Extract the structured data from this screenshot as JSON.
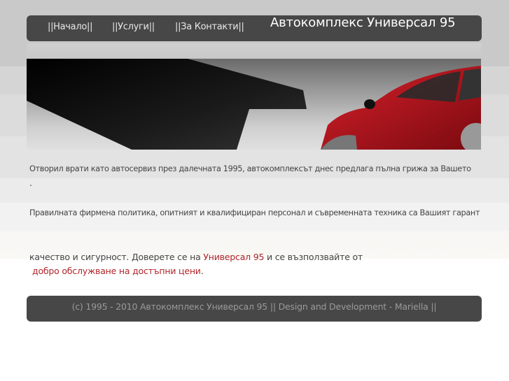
{
  "nav": {
    "items": [
      {
        "label": "||Начало||"
      },
      {
        "label": "||Услуги||"
      },
      {
        "label": "||За Контакти||"
      }
    ]
  },
  "site_title": "Автокомплекс Универсал 95",
  "content": {
    "p1": "Отворил врати като автосервиз през далечната 1995, автокомплексът днес предлага пълна грижа за Вашето",
    "p1_end": ".",
    "p2": "Правилната фирмена политика, опитният и квалифициран персонал и съвременната техника са Вашият гарант",
    "p3_a": "качество и сигурност. Доверете се на ",
    "p3_link": "Универсал 95",
    "p3_b": " и се възползвайте от",
    "p4_link": "добро обслужване на достъпни цени",
    "p4_end": "."
  },
  "footer": {
    "text": "(c) 1995 - 2010 Автокомплекс Универсал 95 || Design and Development - Mariella ||"
  },
  "colors": {
    "bar": "#474747",
    "accent": "#b0252a"
  }
}
